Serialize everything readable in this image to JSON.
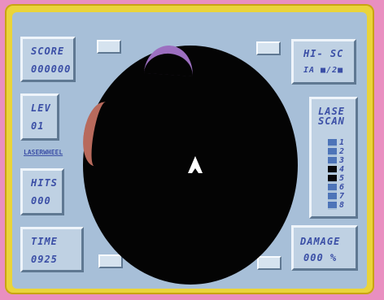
{
  "score": {
    "label": "SCORE",
    "value": "000000"
  },
  "hisc": {
    "label": "HI- SC",
    "value": "IA  ■/2■"
  },
  "level": {
    "label": "LEV",
    "value": "01"
  },
  "weapon": {
    "label": "LASERWHEEL"
  },
  "hits": {
    "label": "HITS",
    "value": "000"
  },
  "time": {
    "label": "TIME",
    "value": "0925"
  },
  "laser_scan": {
    "label_line1": "LASE",
    "label_line2": "SCAN",
    "levels": [
      "1",
      "2",
      "3",
      "4",
      "5",
      "6",
      "7",
      "8"
    ],
    "active_levels": [
      "4",
      "5"
    ]
  },
  "damage": {
    "label": "DAMAGE",
    "value": "000 %"
  },
  "colors": {
    "background": "#e98fc0",
    "frame": "#ead43a",
    "screen": "#a7bfd8",
    "panel_text": "#3b4fa6",
    "radar": "#040404",
    "ship": "#ffffff"
  },
  "icons": {
    "ship": "player-ship-arrow",
    "radar": "circular-radar"
  }
}
